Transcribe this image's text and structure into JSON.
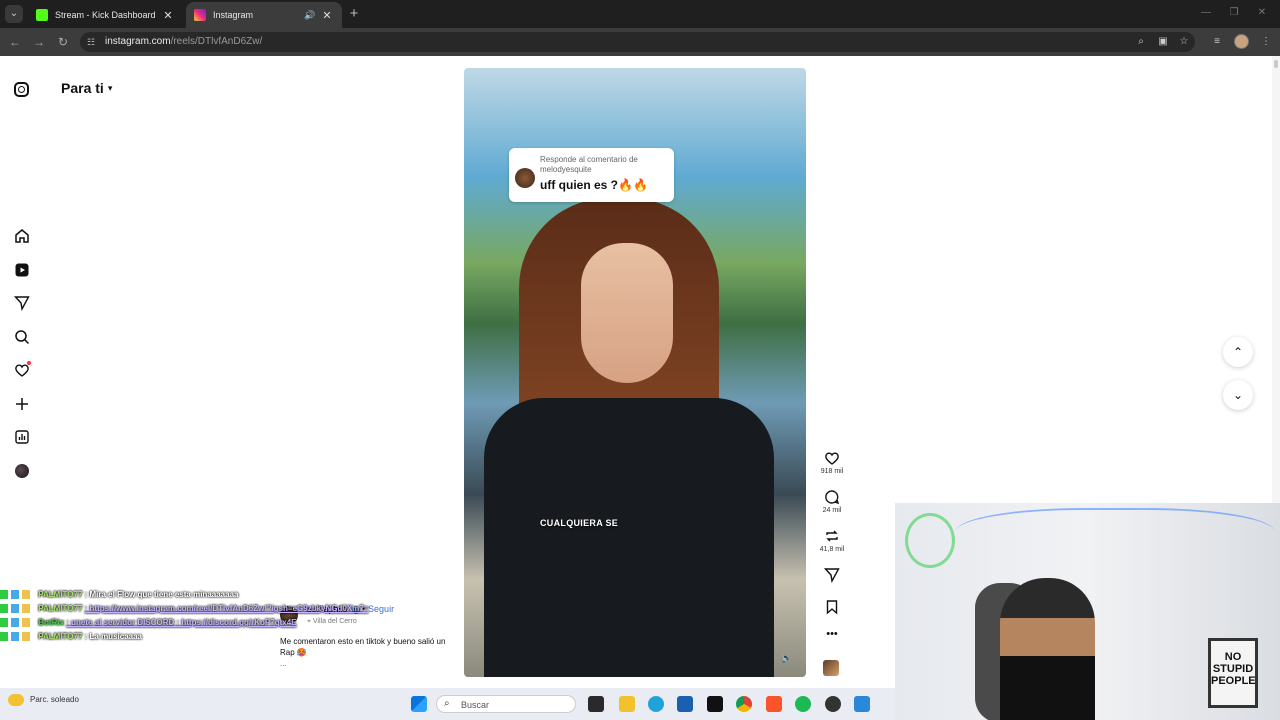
{
  "browser": {
    "tabs": [
      {
        "title": "Stream - Kick Dashboard",
        "favicon_color": "#53fc18",
        "active": false
      },
      {
        "title": "Instagram",
        "favicon_color": "#e1306c",
        "active": true
      }
    ],
    "url_host": "instagram.com",
    "url_path": "/reels/DTlvfAnD6Zw/"
  },
  "instagram": {
    "feed_title": "Para ti",
    "reel": {
      "reply_header": "Responde al comentario de melodyesquite",
      "reply_message": "uff quien es ?🔥🔥",
      "overlay_caption": "CUALQUIERA SE",
      "likes": "918 mil",
      "comments": "24 mil",
      "reposts": "41,8 mil",
      "author": "soffiaphilo",
      "follow": "Seguir",
      "location": "Villa del Cerro",
      "caption": "Me comentaron esto en tiktok y bueno salió un Rap 🥵",
      "caption_more": "..."
    }
  },
  "chat": [
    {
      "user": "PALMITO77",
      "msg": ": Mira el Flow que tiene esta minaaaaaaa",
      "link": false,
      "bot": false
    },
    {
      "user": "PALMITO77",
      "msg": ": https://www.instagram.com/reel/DTlvfAnD6Zw/?igsh=eG9zbkyNGd0Xm7=",
      "link": true,
      "bot": false
    },
    {
      "user": "BotRix",
      "msg": ": unete al servidor DISCORD : https://discord.gg/rKoP7qtx4E",
      "link": true,
      "bot": true
    },
    {
      "user": "PALMITO77",
      "msg": ": La musicaaaa",
      "link": false,
      "bot": false
    }
  ],
  "taskbar": {
    "weather": "Parc. soleado",
    "search_placeholder": "Buscar"
  },
  "webcam": {
    "sign_text": "NO STUPID PEOPLE"
  }
}
